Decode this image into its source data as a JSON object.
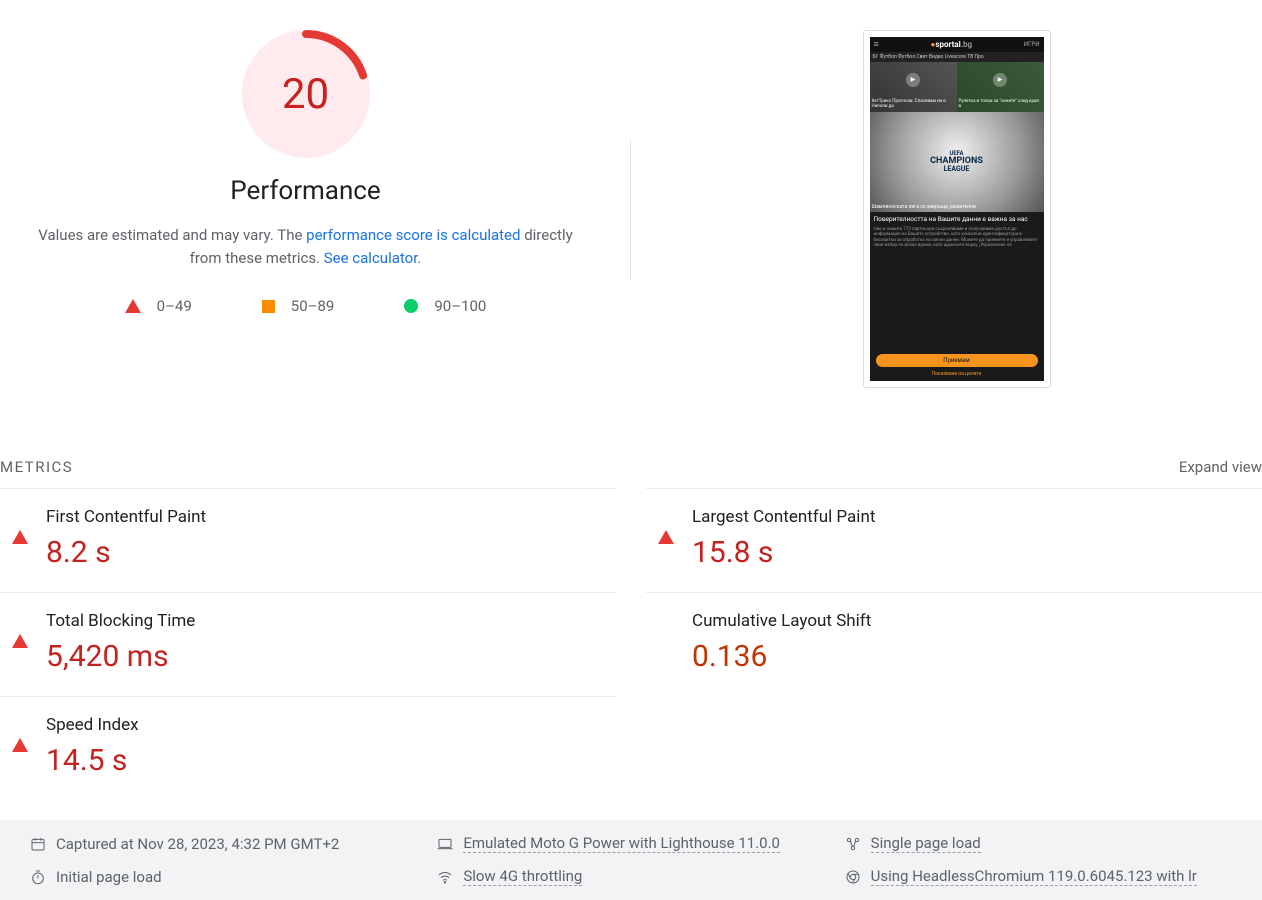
{
  "gauge": {
    "score": "20",
    "title": "Performance",
    "desc_pre": "Values are estimated and may vary. The ",
    "desc_link1": "performance score is calculated",
    "desc_mid": " directly from these metrics. ",
    "desc_link2": "See calculator",
    "desc_post": "."
  },
  "legend": {
    "low": "0–49",
    "mid": "50–89",
    "high": "90–100"
  },
  "screenshot": {
    "logo_main": "sportal",
    "logo_suffix": ".bg",
    "header_right": "ИГРИ",
    "nav": "БГ Футбол   Футбол Свят   Видео   Livescore   ТВ Про",
    "thumb1": "ХетТрикс Прогнози: Спасявам ли в Наполи да",
    "thumb2": "Рулетка и топки за \"сините\" след края в",
    "ucl_line1": "UEFA",
    "ucl_line2": "CHAMPIONS",
    "ucl_line3": "LEAGUE",
    "hero_caption": "Шампионската лига се завръща, решителни",
    "consent_head": "Поверителността на Вашите данни е важна за нас",
    "consent_body": "Ние и нашите 772 партньори съхраняваме и получаваме достъп до информация на Вашето устройство, като уникални идентификатори в бисквитки за обработка на лични данни. Можете да приемете и управлявате своя избор по всяко време, като щракнете върху „Управление на",
    "consent_btn": "Приемам",
    "consent_link": "Показване на целите"
  },
  "metrics_header": {
    "label": "METRICS",
    "expand": "Expand view"
  },
  "metrics": {
    "fcp": {
      "title": "First Contentful Paint",
      "value": "8.2 s"
    },
    "lcp": {
      "title": "Largest Contentful Paint",
      "value": "15.8 s"
    },
    "tbt": {
      "title": "Total Blocking Time",
      "value": "5,420 ms"
    },
    "cls": {
      "title": "Cumulative Layout Shift",
      "value": "0.136"
    },
    "si": {
      "title": "Speed Index",
      "value": "14.5 s"
    }
  },
  "footer": {
    "captured": "Captured at Nov 28, 2023, 4:32 PM GMT+2",
    "emulated": "Emulated Moto G Power with Lighthouse 11.0.0",
    "single": "Single page load",
    "initial": "Initial page load",
    "throttling": "Slow 4G throttling",
    "chromium": "Using HeadlessChromium 119.0.6045.123 with lr"
  }
}
